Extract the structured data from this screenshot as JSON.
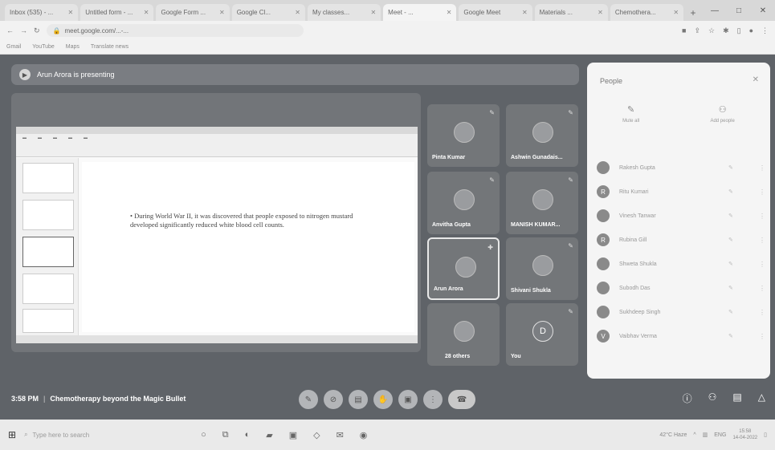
{
  "browser": {
    "tabs": [
      {
        "label": "Inbox (535) - ...",
        "active": false
      },
      {
        "label": "Untitled form - ...",
        "active": false
      },
      {
        "label": "Google Form ...",
        "active": false
      },
      {
        "label": "Google Cl...",
        "active": false
      },
      {
        "label": "My classes...",
        "active": false
      },
      {
        "label": "Meet - ...",
        "active": true
      },
      {
        "label": "Google Meet",
        "active": false
      },
      {
        "label": "Materials ...",
        "active": false
      },
      {
        "label": "Chemothera...",
        "active": false
      }
    ],
    "new_tab": "+",
    "window_buttons": [
      "—",
      "□",
      "✕"
    ],
    "url": "meet.google.com/...-...",
    "bookmarks": [
      "Gmail",
      "YouTube",
      "Maps",
      "Translate news"
    ]
  },
  "meet": {
    "presenting_banner": "Arun Arora is presenting",
    "slide_text": "• During World War II, it was discovered that people exposed to nitrogen mustard developed significantly reduced white blood cell counts.",
    "tiles": [
      {
        "name": "Pinta Kumar"
      },
      {
        "name": "Ashwin Gunadais..."
      },
      {
        "name": "Anvitha Gupta"
      },
      {
        "name": "MANISH KUMAR..."
      },
      {
        "name": "Arun Arora"
      },
      {
        "name": "Shivani Shukla"
      },
      {
        "name": "28 others"
      },
      {
        "name": "You",
        "letter": "D"
      }
    ],
    "people_panel": {
      "title": "People",
      "actions": [
        "Mute all",
        "Add people"
      ],
      "list": [
        {
          "name": "Rakesh Gupta",
          "letter": ""
        },
        {
          "name": "Ritu Kumari",
          "letter": "R"
        },
        {
          "name": "Vinesh Tanwar",
          "letter": ""
        },
        {
          "name": "Rubina Gill",
          "letter": "R"
        },
        {
          "name": "Shweta Shukla",
          "letter": ""
        },
        {
          "name": "Subodh Das",
          "letter": ""
        },
        {
          "name": "Sukhdeep Singh",
          "letter": ""
        },
        {
          "name": "Vaibhav Verma",
          "letter": "V"
        }
      ]
    },
    "time": "3:58 PM",
    "meeting_title": "Chemotherapy beyond the Magic Bullet"
  },
  "taskbar": {
    "search_placeholder": "Type here to search",
    "weather": "42°C Haze",
    "lang": "ENG",
    "time": "15:58",
    "date": "14-04-2022"
  }
}
